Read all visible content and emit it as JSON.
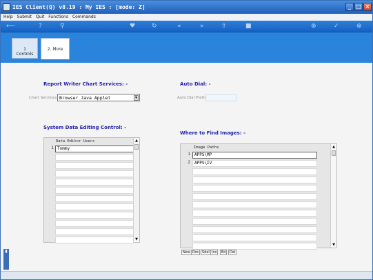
{
  "window": {
    "title": "IES Client(Q) v8.19 : My IES :      [mode: Z]"
  },
  "menu": [
    "Help",
    "Submit",
    "Quit",
    "Functions",
    "Commands"
  ],
  "toolbar": {
    "icons": [
      "back-arrow-icon",
      "help-icon",
      "search-icon",
      "heart-icon",
      "refresh-icon",
      "rewind-icon",
      "forward-icon",
      "export-icon",
      "stop-icon",
      "add-icon",
      "confirm-icon",
      "close-icon"
    ],
    "glyphs": [
      "⟵",
      "?",
      "⚲",
      "♥",
      "↻",
      "«",
      "»",
      "⇧",
      "■",
      "⊕",
      "✓",
      "⊗"
    ]
  },
  "tabs": [
    {
      "label": "1 Controls",
      "active": false
    },
    {
      "label": "2. More",
      "active": true
    }
  ],
  "report_writer": {
    "heading": "Report Writer Chart Services: -",
    "label": "Chart Services",
    "value": "Browser Java Applet"
  },
  "auto_dial": {
    "heading": "Auto Dial: -",
    "label": "Auto Dial Prefix"
  },
  "data_editing": {
    "heading": "System Data Editing Control: -",
    "column": "Data Editor Users",
    "rows": [
      {
        "num": "1",
        "value": "Tommy"
      }
    ]
  },
  "images": {
    "heading": "Where to Find Images: -",
    "column": "Image Paths",
    "rows": [
      {
        "num": "1",
        "value": "APPS\\MP"
      },
      {
        "num": "2",
        "value": "APPS\\IV"
      }
    ],
    "buttons": [
      "New",
      "Dre",
      "Sdel",
      "Ins",
      "Ed",
      "Del"
    ]
  }
}
